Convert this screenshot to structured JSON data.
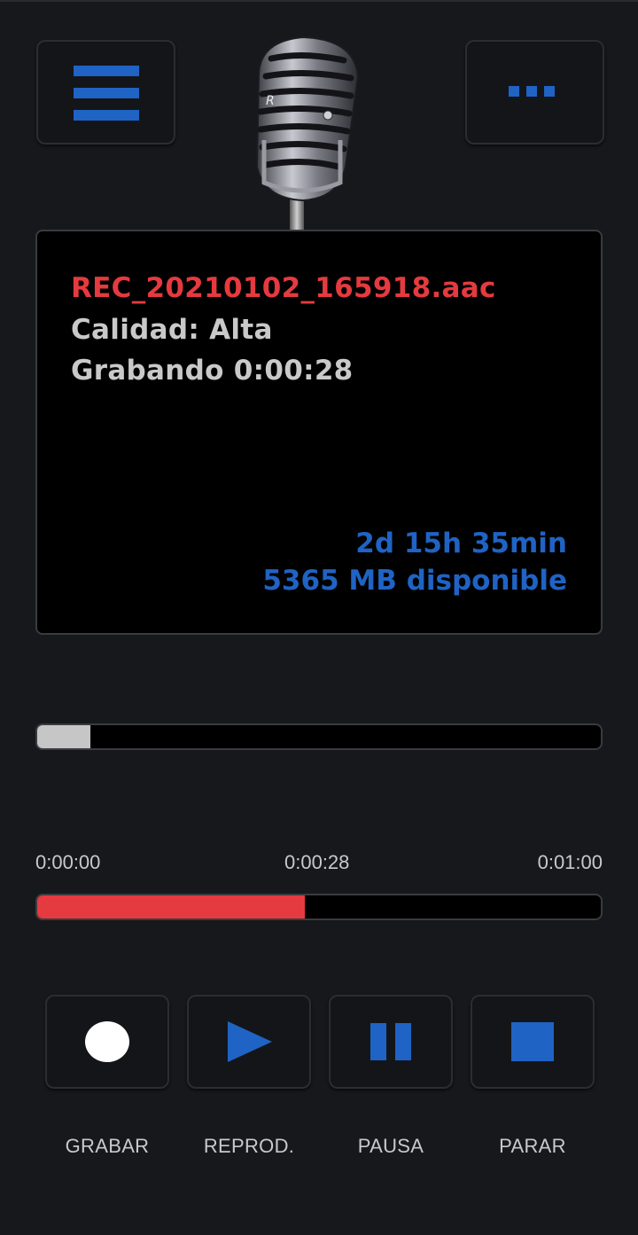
{
  "header": {
    "menu_icon": "hamburger-menu-icon",
    "more_icon": "more-options-icon",
    "logo_icon": "microphone-icon",
    "accent_color": "#1f63c4"
  },
  "display": {
    "filename": "REC_20210102_165918.aac",
    "quality": "Calidad: Alta",
    "recording_status": "Grabando 0:00:28",
    "remaining_time": "2d 15h 35min",
    "available_space": "5365 MB disponible",
    "filename_color": "#e53a3f"
  },
  "level_meter": {
    "level_percent": 9.5
  },
  "timeline": {
    "start": "0:00:00",
    "current": "0:00:28",
    "end": "0:01:00",
    "progress_percent": 47.5
  },
  "controls": [
    {
      "label": "GRABAR",
      "icon": "record-icon"
    },
    {
      "label": "REPROD.",
      "icon": "play-icon"
    },
    {
      "label": "PAUSA",
      "icon": "pause-icon"
    },
    {
      "label": "PARAR",
      "icon": "stop-icon"
    }
  ]
}
